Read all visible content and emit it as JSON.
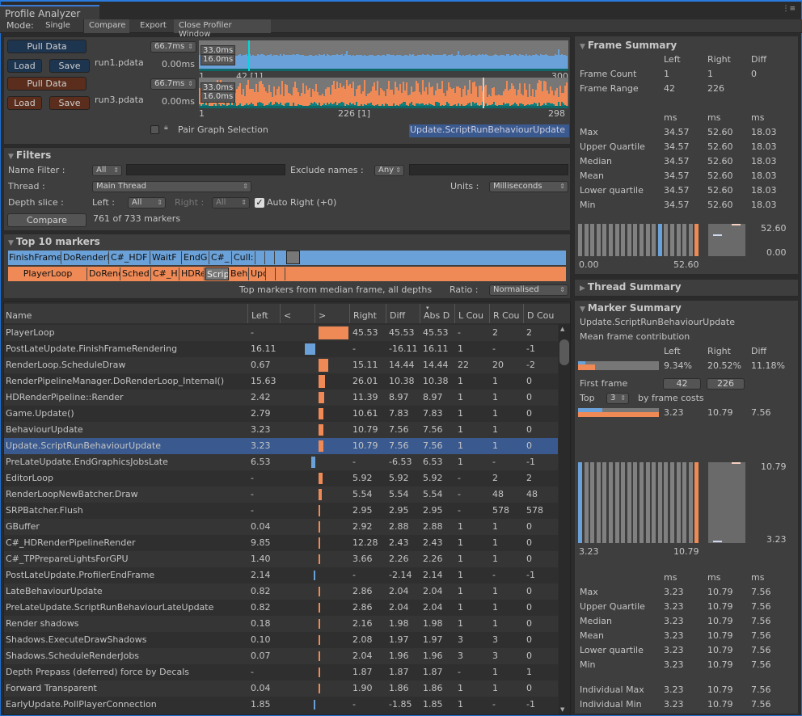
{
  "window": {
    "tab": "Profile Analyzer"
  },
  "toolbar": {
    "mode_label": "Mode:",
    "single": "Single",
    "compare": "Compare",
    "export": "Export",
    "close": "Close Profiler Window"
  },
  "data_sources": [
    {
      "pull": "Pull Data",
      "load": "Load",
      "save": "Save",
      "file": "run1.pdata",
      "scale": "66.7ms",
      "zero": "0.00ms",
      "l1": "33.0ms",
      "l2": "16.0ms",
      "x_start": "1",
      "x_sel": "42 [1]",
      "x_end": "300",
      "color": "#6aa1d8"
    },
    {
      "pull": "Pull Data",
      "load": "Load",
      "save": "Save",
      "file": "run3.pdata",
      "scale": "66.7ms",
      "zero": "0.00ms",
      "l1": "33.0ms",
      "l2": "16.0ms",
      "x_start": "1",
      "x_sel": "226 [1]",
      "x_end": "298",
      "color": "#ef8a56"
    }
  ],
  "pair_graph": {
    "label": "Pair Graph Selection",
    "checked": false
  },
  "selected_marker": "Update.ScriptRunBehaviourUpdate",
  "filters": {
    "title": "Filters",
    "name_filter": "Name Filter :",
    "name_mode": "All",
    "name_value": "",
    "exclude": "Exclude names :",
    "exclude_mode": "Any",
    "exclude_value": "",
    "thread": "Thread :",
    "thread_value": "Main Thread",
    "units": "Units :",
    "units_value": "Milliseconds",
    "depth": "Depth slice :",
    "left": "Left :",
    "left_value": "All",
    "right": "Right :",
    "right_value": "All",
    "auto_right": "Auto Right (+0)",
    "auto_right_checked": true,
    "compare": "Compare",
    "marker_count": "761 of 733 markers"
  },
  "top10": {
    "title": "Top 10 markers",
    "left": [
      "FinishFrameRe",
      "DoRenderLoo",
      "C#_HDF",
      "WaitF",
      "EndG",
      "C#_",
      "Cull:",
      "",
      "",
      ""
    ],
    "right": [
      "PlayerLoop",
      "DoRenderLo",
      "Sched",
      "C#_H",
      "HDRe",
      "Scrip",
      "Beha",
      "Upd",
      "",
      ""
    ],
    "note": "Top markers from median frame, all depths",
    "ratio": "Ratio :",
    "ratio_value": "Normalised"
  },
  "table": {
    "headers": [
      "Name",
      "Left",
      "<",
      ">",
      "Right",
      "Diff",
      "Abs D",
      "L Cou",
      "R Cou",
      "D Cou"
    ],
    "rows": [
      [
        "PlayerLoop",
        "-",
        "45.53",
        "45.53",
        "45.53",
        "-",
        "2",
        "2"
      ],
      [
        "PostLateUpdate.FinishFrameRendering",
        "16.11",
        "-",
        "-16.11",
        "16.11",
        "1",
        "-",
        "-1"
      ],
      [
        "RenderLoop.ScheduleDraw",
        "0.67",
        "15.11",
        "14.44",
        "14.44",
        "22",
        "20",
        "-2"
      ],
      [
        "RenderPipelineManager.DoRenderLoop_Internal()",
        "15.63",
        "26.01",
        "10.38",
        "10.38",
        "1",
        "1",
        "0"
      ],
      [
        "HDRenderPipeline::Render",
        "2.42",
        "11.39",
        "8.97",
        "8.97",
        "1",
        "1",
        "0"
      ],
      [
        "Game.Update()",
        "2.79",
        "10.61",
        "7.83",
        "7.83",
        "1",
        "1",
        "0"
      ],
      [
        "BehaviourUpdate",
        "3.23",
        "10.79",
        "7.56",
        "7.56",
        "1",
        "1",
        "0"
      ],
      [
        "Update.ScriptRunBehaviourUpdate",
        "3.23",
        "10.79",
        "7.56",
        "7.56",
        "1",
        "1",
        "0"
      ],
      [
        "PreLateUpdate.EndGraphicsJobsLate",
        "6.53",
        "-",
        "-6.53",
        "6.53",
        "1",
        "-",
        "-1"
      ],
      [
        "EditorLoop",
        "-",
        "5.92",
        "5.92",
        "5.92",
        "-",
        "2",
        "2"
      ],
      [
        "RenderLoopNewBatcher.Draw",
        "-",
        "5.54",
        "5.54",
        "5.54",
        "-",
        "48",
        "48"
      ],
      [
        "SRPBatcher.Flush",
        "-",
        "2.95",
        "2.95",
        "2.95",
        "-",
        "578",
        "578"
      ],
      [
        "GBuffer",
        "0.04",
        "2.92",
        "2.88",
        "2.88",
        "1",
        "1",
        "0"
      ],
      [
        "C#_HDRenderPipelineRender",
        "9.85",
        "12.28",
        "2.43",
        "2.43",
        "1",
        "1",
        "0"
      ],
      [
        "C#_TPPrepareLightsForGPU",
        "1.40",
        "3.66",
        "2.26",
        "2.26",
        "1",
        "1",
        "0"
      ],
      [
        "PostLateUpdate.ProfilerEndFrame",
        "2.14",
        "-",
        "-2.14",
        "2.14",
        "1",
        "-",
        "-1"
      ],
      [
        "LateBehaviourUpdate",
        "0.82",
        "2.86",
        "2.04",
        "2.04",
        "1",
        "1",
        "0"
      ],
      [
        "PreLateUpdate.ScriptRunBehaviourLateUpdate",
        "0.82",
        "2.86",
        "2.04",
        "2.04",
        "1",
        "1",
        "0"
      ],
      [
        "Render shadows",
        "0.18",
        "2.16",
        "1.98",
        "1.98",
        "1",
        "1",
        "0"
      ],
      [
        "Shadows.ExecuteDrawShadows",
        "0.10",
        "2.08",
        "1.97",
        "1.97",
        "3",
        "3",
        "0"
      ],
      [
        "Shadows.ScheduleRenderJobs",
        "0.07",
        "2.04",
        "1.96",
        "1.96",
        "3",
        "3",
        "0"
      ],
      [
        "Depth Prepass (deferred) force by Decals",
        "-",
        "1.87",
        "1.87",
        "1.87",
        "-",
        "1",
        "1"
      ],
      [
        "Forward Transparent",
        "0.04",
        "1.90",
        "1.86",
        "1.86",
        "1",
        "1",
        "0"
      ],
      [
        "EarlyUpdate.PollPlayerConnection",
        "1.85",
        "-",
        "-1.85",
        "1.85",
        "1",
        "-",
        "-1"
      ]
    ],
    "selected_index": 7
  },
  "frame_summary": {
    "title": "Frame Summary",
    "cols": [
      "Left",
      "Right",
      "Diff"
    ],
    "count": [
      "Frame Count",
      "1",
      "1",
      "0"
    ],
    "range": [
      "Frame Range",
      "42",
      "226",
      ""
    ],
    "units": [
      "ms",
      "ms",
      "ms"
    ],
    "stats": [
      [
        "Max",
        "34.57",
        "52.60",
        "18.03"
      ],
      [
        "Upper Quartile",
        "34.57",
        "52.60",
        "18.03"
      ],
      [
        "Median",
        "34.57",
        "52.60",
        "18.03"
      ],
      [
        "Mean",
        "34.57",
        "52.60",
        "18.03"
      ],
      [
        "Lower quartile",
        "34.57",
        "52.60",
        "18.03"
      ],
      [
        "Min",
        "34.57",
        "52.60",
        "18.03"
      ]
    ],
    "hist_min": "0.00",
    "hist_max": "52.60",
    "box_max": "52.60",
    "box_min": "0.00"
  },
  "thread_summary": {
    "title": "Thread Summary"
  },
  "marker_summary": {
    "title": "Marker Summary",
    "marker": "Update.ScriptRunBehaviourUpdate",
    "contribution": "Mean frame contribution",
    "cols": [
      "Left",
      "Right",
      "Diff"
    ],
    "pct": [
      "9.34%",
      "20.52%",
      "11.18%"
    ],
    "pct_values": [
      9.34,
      20.52
    ],
    "first_frame": "First frame",
    "first_left": "42",
    "first_right": "226",
    "top": "Top",
    "top_n": "3",
    "by": "by frame costs",
    "top_vals": [
      "3.23",
      "10.79",
      "7.56"
    ],
    "hist_min": "3.23",
    "hist_max": "10.79",
    "box_max": "10.79",
    "box_min": "3.23",
    "units": [
      "ms",
      "ms",
      "ms"
    ],
    "stats": [
      [
        "Max",
        "3.23",
        "10.79",
        "7.56"
      ],
      [
        "Upper Quartile",
        "3.23",
        "10.79",
        "7.56"
      ],
      [
        "Median",
        "3.23",
        "10.79",
        "7.56"
      ],
      [
        "Mean",
        "3.23",
        "10.79",
        "7.56"
      ],
      [
        "Lower quartile",
        "3.23",
        "10.79",
        "7.56"
      ],
      [
        "Min",
        "3.23",
        "10.79",
        "7.56"
      ]
    ],
    "indiv": [
      [
        "Individual Max",
        "3.23",
        "10.79",
        "7.56"
      ],
      [
        "Individual Min",
        "3.23",
        "10.79",
        "7.56"
      ]
    ]
  },
  "colors": {
    "left": "#6aa1d8",
    "right": "#ef8a56",
    "selection": "#3a5a8f",
    "teal": "#0e8080"
  }
}
